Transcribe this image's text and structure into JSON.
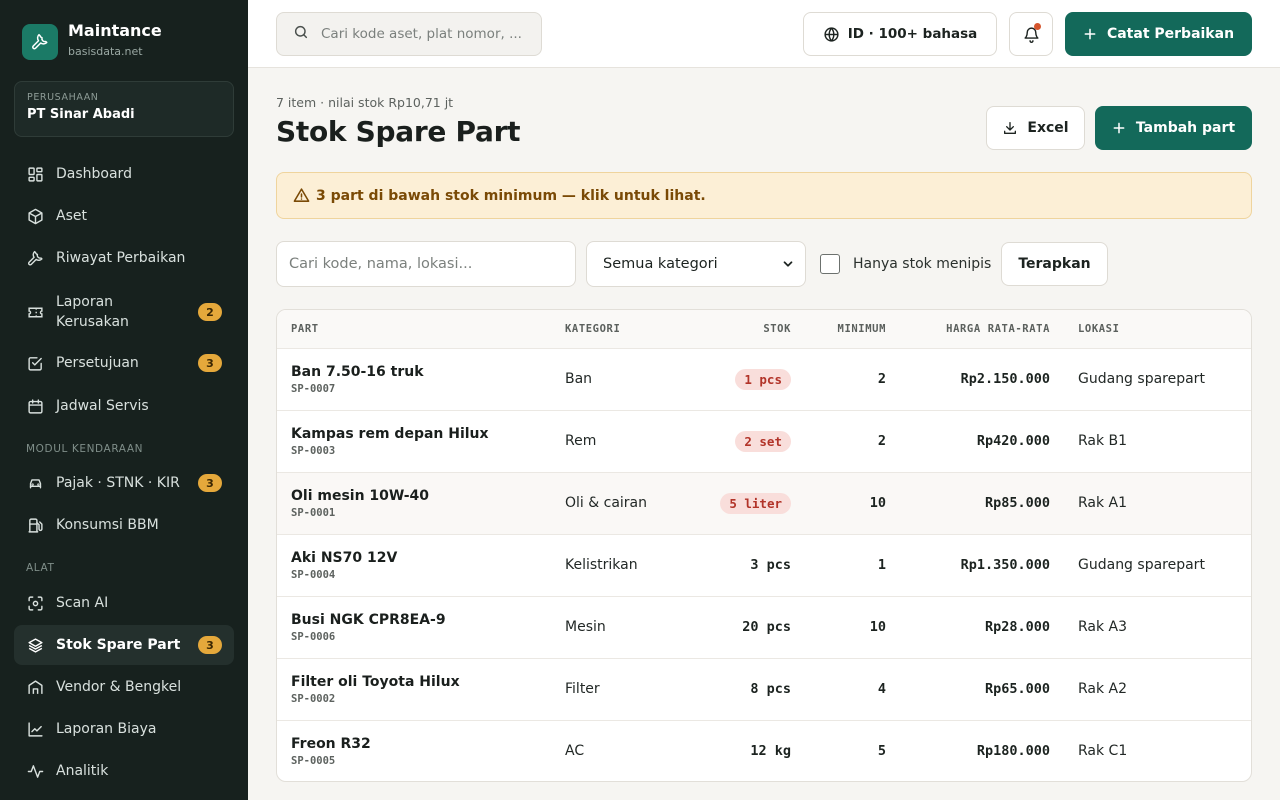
{
  "brand": {
    "name": "Maintance",
    "domain": "basisdata.net"
  },
  "company": {
    "label": "PERUSAHAAN",
    "name": "PT Sinar Abadi"
  },
  "nav": {
    "dashboard": "Dashboard",
    "aset": "Aset",
    "riwayat": "Riwayat Perbaikan",
    "laporan_kerusakan": {
      "label": "Laporan Kerusakan",
      "badge": "2"
    },
    "persetujuan": {
      "label": "Persetujuan",
      "badge": "3"
    },
    "jadwal": "Jadwal Servis",
    "section_kendaraan": "MODUL KENDARAAN",
    "pajak": {
      "label": "Pajak · STNK · KIR",
      "badge": "3"
    },
    "bbm": "Konsumsi BBM",
    "section_alat": "ALAT",
    "scan": "Scan AI",
    "stok": {
      "label": "Stok Spare Part",
      "badge": "3"
    },
    "vendor": "Vendor & Bengkel",
    "laporan_biaya": "Laporan Biaya",
    "analitik": "Analitik"
  },
  "topbar": {
    "search_placeholder": "Cari kode aset, plat nomor, ...",
    "language": "ID · 100+ bahasa",
    "catat_label": "Catat Perbaikan"
  },
  "page": {
    "meta": "7 item · nilai stok Rp10,71 jt",
    "title": "Stok Spare Part",
    "excel_label": "Excel",
    "add_label": "Tambah part",
    "alert": "3 part di bawah stok minimum — klik untuk lihat."
  },
  "filters": {
    "search_placeholder": "Cari kode, nama, lokasi...",
    "category_selected": "Semua kategori",
    "low_stock_label": "Hanya stok menipis",
    "apply_label": "Terapkan"
  },
  "table": {
    "headers": {
      "part": "PART",
      "kategori": "KATEGORI",
      "stok": "STOK",
      "minimum": "MINIMUM",
      "harga": "HARGA RATA-RATA",
      "lokasi": "LOKASI"
    },
    "rows": [
      {
        "name": "Ban 7.50-16 truk",
        "code": "SP-0007",
        "kategori": "Ban",
        "stok": "1 pcs",
        "minimum": "2",
        "harga": "Rp2.150.000",
        "lokasi": "Gudang sparepart"
      },
      {
        "name": "Kampas rem depan Hilux",
        "code": "SP-0003",
        "kategori": "Rem",
        "stok": "2 set",
        "minimum": "2",
        "harga": "Rp420.000",
        "lokasi": "Rak B1"
      },
      {
        "name": "Oli mesin 10W-40",
        "code": "SP-0001",
        "kategori": "Oli & cairan",
        "stok": "5 liter",
        "minimum": "10",
        "harga": "Rp85.000",
        "lokasi": "Rak A1"
      },
      {
        "name": "Aki NS70 12V",
        "code": "SP-0004",
        "kategori": "Kelistrikan",
        "stok": "3 pcs",
        "minimum": "1",
        "harga": "Rp1.350.000",
        "lokasi": "Gudang sparepart"
      },
      {
        "name": "Busi NGK CPR8EA-9",
        "code": "SP-0006",
        "kategori": "Mesin",
        "stok": "20 pcs",
        "minimum": "10",
        "harga": "Rp28.000",
        "lokasi": "Rak A3"
      },
      {
        "name": "Filter oli Toyota Hilux",
        "code": "SP-0002",
        "kategori": "Filter",
        "stok": "8 pcs",
        "minimum": "4",
        "harga": "Rp65.000",
        "lokasi": "Rak A2"
      },
      {
        "name": "Freon R32",
        "code": "SP-0005",
        "kategori": "AC",
        "stok": "12 kg",
        "minimum": "5",
        "harga": "Rp180.000",
        "lokasi": "Rak C1"
      }
    ]
  },
  "colors": {
    "primary": "#13695a",
    "sidebar": "#17211e",
    "badge": "#e5a83b",
    "alert_bg": "#fcefd6",
    "low_stock": "#b23429"
  },
  "icons": [
    "wrench-icon",
    "grid-icon",
    "cube-icon",
    "wrench-icon",
    "ticket-icon",
    "check-square-icon",
    "calendar-icon",
    "car-icon",
    "fuel-icon",
    "scan-icon",
    "layers-icon",
    "building-icon",
    "chart-line-icon",
    "activity-icon",
    "search-icon",
    "globe-icon",
    "bell-icon",
    "plus-icon",
    "download-icon",
    "warning-icon",
    "chevron-down-icon"
  ]
}
